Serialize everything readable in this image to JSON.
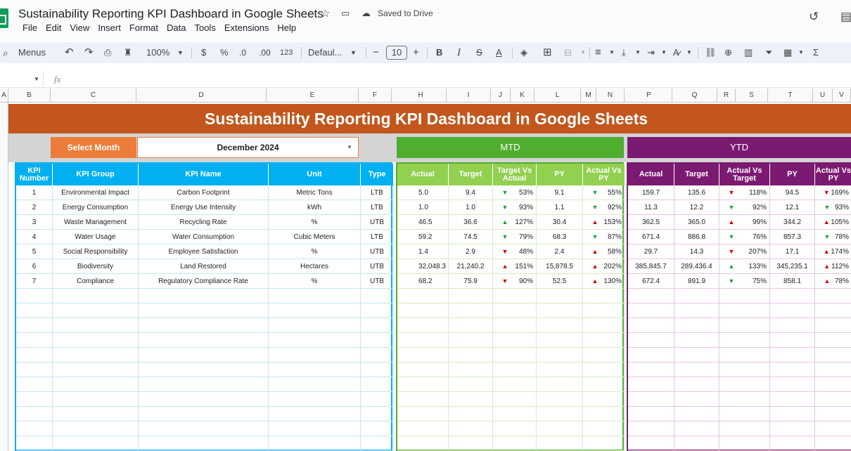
{
  "doc": {
    "title": "Sustainability Reporting KPI Dashboard in Google Sheets",
    "saved": "Saved to Drive"
  },
  "menu": [
    "File",
    "Edit",
    "View",
    "Insert",
    "Format",
    "Data",
    "Tools",
    "Extensions",
    "Help"
  ],
  "toolbar": {
    "menus": "Menus",
    "zoom": "100%",
    "currency": "$",
    "percent": "%",
    "dec_dec": ".0",
    "inc_dec": ".00",
    "numfmt": "123",
    "font": "Defaul...",
    "size": "10"
  },
  "formula": {
    "fx": "fx"
  },
  "columns": [
    "A",
    "B",
    "C",
    "D",
    "E",
    "F",
    "H",
    "I",
    "J",
    "K",
    "L",
    "M",
    "N",
    "P",
    "Q",
    "R",
    "S",
    "T",
    "U",
    "V"
  ],
  "dashboard": {
    "title": "Sustainability Reporting KPI Dashboard in Google Sheets",
    "select_month_label": "Select Month",
    "month": "December 2024",
    "mtd_label": "MTD",
    "ytd_label": "YTD"
  },
  "kpi_headers": [
    "KPI Number",
    "KPI Group",
    "KPI Name",
    "Unit",
    "Type"
  ],
  "mtd_headers": [
    "Actual",
    "Target",
    "Target Vs Actual",
    "PY",
    "Actual Vs PY"
  ],
  "ytd_headers": [
    "Actual",
    "Target",
    "Actual Vs Target",
    "PY",
    "Actual Vs PY"
  ],
  "colors": {
    "banner": "#c2561c",
    "kpi_header": "#00b0f0",
    "mtd_header": "#92d050",
    "ytd_header": "#7b1a71",
    "up": "#1f9d3a",
    "down": "#d40000"
  },
  "rows": [
    {
      "num": "1",
      "group": "Environmental Impact",
      "name": "Carbon Footprint",
      "unit": "Metric Tons",
      "type": "LTB",
      "mtd": {
        "actual": "5.0",
        "target": "9.4",
        "tva_dir": "down",
        "tva": "53%",
        "py": "9.1",
        "apy_dir": "down",
        "apy": "55%"
      },
      "ytd": {
        "actual": "159.7",
        "target": "135.6",
        "avt_dir": "down",
        "avt": "118%",
        "py": "94.5",
        "apy_dir": "down",
        "apy": "169%"
      }
    },
    {
      "num": "2",
      "group": "Energy Consumption",
      "name": "Energy Use Intensity",
      "unit": "kWh",
      "type": "LTB",
      "mtd": {
        "actual": "1.0",
        "target": "1.0",
        "tva_dir": "down",
        "tva": "93%",
        "py": "1.1",
        "apy_dir": "down",
        "apy": "92%"
      },
      "ytd": {
        "actual": "11.3",
        "target": "12.2",
        "avt_dir": "down",
        "avt": "92%",
        "py": "12.1",
        "apy_dir": "down",
        "apy": "93%"
      }
    },
    {
      "num": "3",
      "group": "Waste Management",
      "name": "Recycling Rate",
      "unit": "%",
      "type": "UTB",
      "mtd": {
        "actual": "46.5",
        "target": "36.6",
        "tva_dir": "up",
        "tva": "127%",
        "py": "30.4",
        "apy_dir": "up",
        "apy": "153%"
      },
      "ytd": {
        "actual": "362.5",
        "target": "365.0",
        "avt_dir": "up",
        "avt": "99%",
        "py": "344.2",
        "apy_dir": "up",
        "apy": "105%"
      }
    },
    {
      "num": "4",
      "group": "Water Usage",
      "name": "Water Consumption",
      "unit": "Cubic Meters",
      "type": "LTB",
      "mtd": {
        "actual": "59.2",
        "target": "74.5",
        "tva_dir": "down",
        "tva": "79%",
        "py": "68.3",
        "apy_dir": "down",
        "apy": "87%"
      },
      "ytd": {
        "actual": "671.4",
        "target": "886.8",
        "avt_dir": "down",
        "avt": "76%",
        "py": "857.3",
        "apy_dir": "down",
        "apy": "78%"
      }
    },
    {
      "num": "5",
      "group": "Social Responsibility",
      "name": "Employee Satisfaction",
      "unit": "%",
      "type": "UTB",
      "mtd": {
        "actual": "1.4",
        "target": "2.9",
        "tva_dir": "up",
        "tva": "48%",
        "py": "2.4",
        "apy_dir": "up",
        "apy": "58%"
      },
      "ytd": {
        "actual": "29.7",
        "target": "14.3",
        "avt_dir": "down",
        "avt": "207%",
        "py": "17.1",
        "apy_dir": "up",
        "apy": "174%"
      }
    },
    {
      "num": "6",
      "group": "Biodiversity",
      "name": "Land Restored",
      "unit": "Hectares",
      "type": "UTB",
      "mtd": {
        "actual": "32,048.3",
        "target": "21,240.2",
        "tva_dir": "up",
        "tva": "151%",
        "py": "15,878.5",
        "apy_dir": "up",
        "apy": "202%"
      },
      "ytd": {
        "actual": "385,845.7",
        "target": "289,436.4",
        "avt_dir": "up",
        "avt": "133%",
        "py": "345,235.1",
        "apy_dir": "up",
        "apy": "112%"
      }
    },
    {
      "num": "7",
      "group": "Compliance",
      "name": "Regulatory Compliance Rate",
      "unit": "%",
      "type": "UTB",
      "mtd": {
        "actual": "68.2",
        "target": "75.9",
        "tva_dir": "up",
        "tva": "90%",
        "py": "52.5",
        "apy_dir": "up",
        "apy": "130%"
      },
      "ytd": {
        "actual": "672.4",
        "target": "891.9",
        "avt_dir": "down",
        "avt": "75%",
        "py": "858.1",
        "apy_dir": "up",
        "apy": "78%"
      }
    }
  ]
}
